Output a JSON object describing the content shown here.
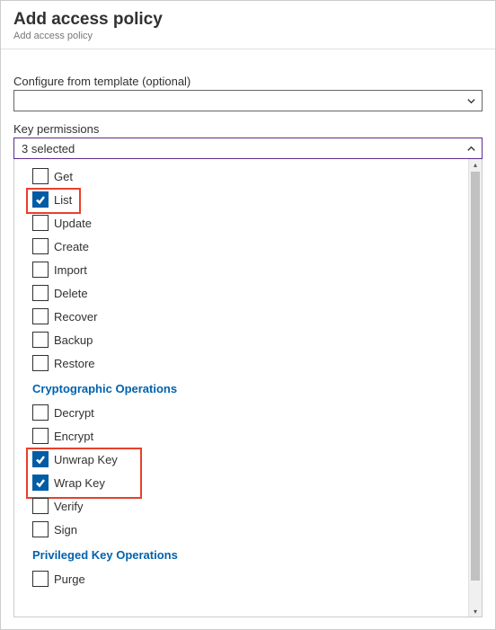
{
  "header": {
    "title": "Add access policy",
    "subtitle": "Add access policy"
  },
  "template_field": {
    "label": "Configure from template (optional)",
    "value": ""
  },
  "key_permissions": {
    "label": "Key permissions",
    "selected_text": "3 selected",
    "sections": [
      {
        "heading": null,
        "items": [
          {
            "label": "Get",
            "checked": false
          },
          {
            "label": "List",
            "checked": true
          },
          {
            "label": "Update",
            "checked": false
          },
          {
            "label": "Create",
            "checked": false
          },
          {
            "label": "Import",
            "checked": false
          },
          {
            "label": "Delete",
            "checked": false
          },
          {
            "label": "Recover",
            "checked": false
          },
          {
            "label": "Backup",
            "checked": false
          },
          {
            "label": "Restore",
            "checked": false
          }
        ]
      },
      {
        "heading": "Cryptographic Operations",
        "items": [
          {
            "label": "Decrypt",
            "checked": false
          },
          {
            "label": "Encrypt",
            "checked": false
          },
          {
            "label": "Unwrap Key",
            "checked": true
          },
          {
            "label": "Wrap Key",
            "checked": true
          },
          {
            "label": "Verify",
            "checked": false
          },
          {
            "label": "Sign",
            "checked": false
          }
        ]
      },
      {
        "heading": "Privileged Key Operations",
        "items": [
          {
            "label": "Purge",
            "checked": false
          }
        ]
      }
    ]
  }
}
